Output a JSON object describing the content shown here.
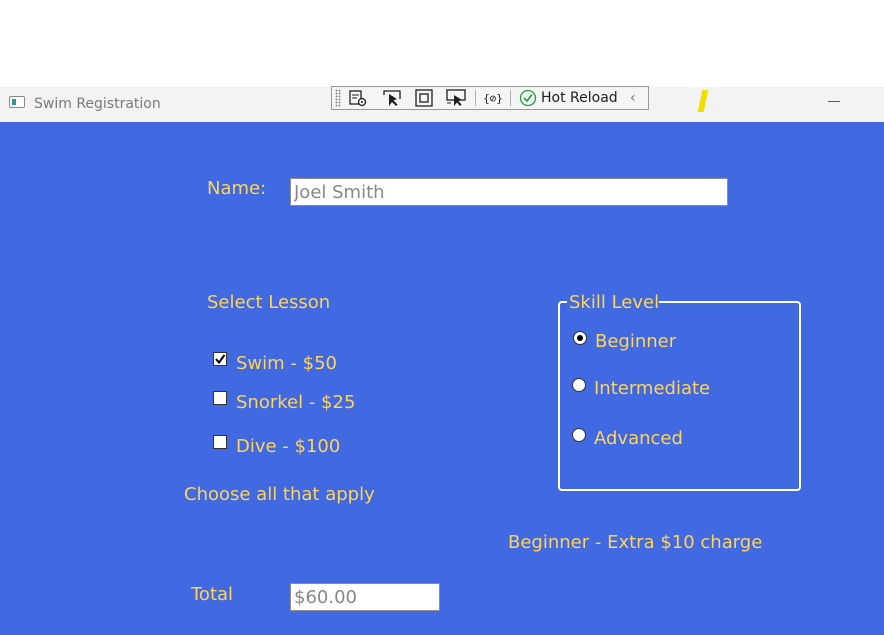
{
  "window": {
    "title": "Swim Registration",
    "toolbar": {
      "hot_reload_label": "Hot Reload",
      "icons": [
        "live-visual-tree-icon",
        "select-element-icon",
        "display-layout-adorners-icon",
        "track-focused-element-icon",
        "binding-failures-icon",
        "hot-reload-status-icon",
        "collapse-chevron-icon"
      ]
    }
  },
  "form": {
    "name_label": "Name:",
    "name_value": "Joel Smith",
    "lesson": {
      "heading": "Select Lesson",
      "options": [
        {
          "label": "Swim - $50",
          "checked": true
        },
        {
          "label": "Snorkel - $25",
          "checked": false
        },
        {
          "label": "Dive - $100",
          "checked": false
        }
      ],
      "hint": "Choose all that apply"
    },
    "skill": {
      "legend": "Skill Level",
      "options": [
        {
          "label": "Beginner",
          "selected": true
        },
        {
          "label": "Intermediate",
          "selected": false
        },
        {
          "label": "Advanced",
          "selected": false
        }
      ],
      "note": "Beginner - Extra $10 charge"
    },
    "total_label": "Total",
    "total_value": "$60.00"
  },
  "colors": {
    "background": "#4169e1",
    "label_text": "#ffd45a",
    "groupbox_border": "#ffffff",
    "hot_reload_ok": "#1e9e3a"
  }
}
